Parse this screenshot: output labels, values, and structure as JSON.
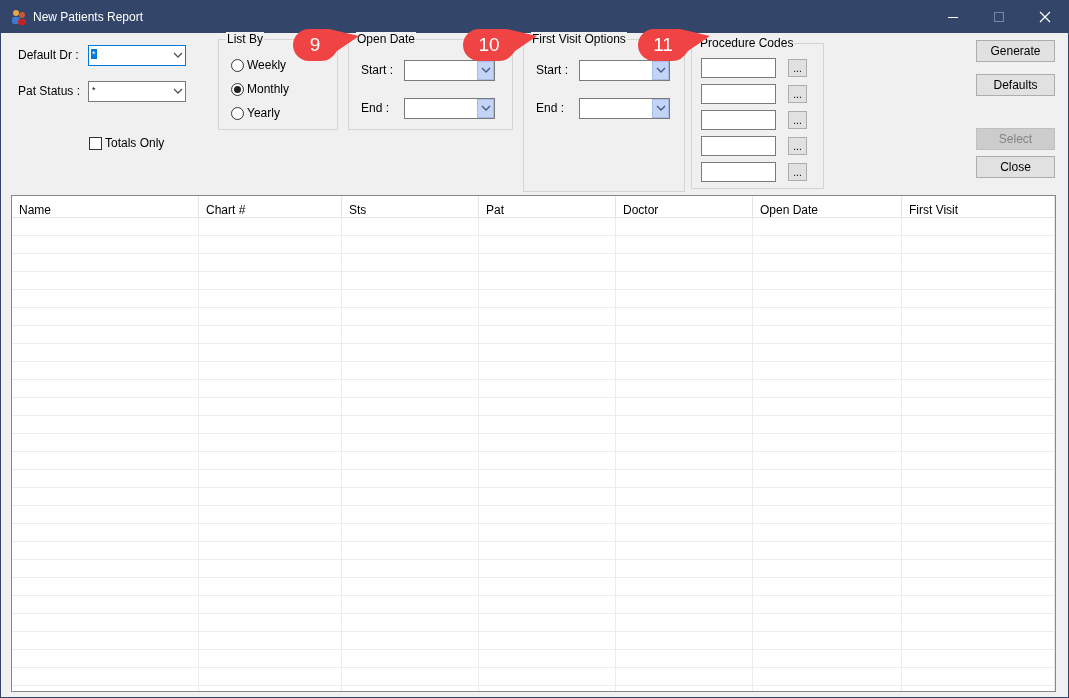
{
  "window": {
    "title": "New Patients Report"
  },
  "filters": [
    {
      "label": "Default Dr :",
      "value": "*",
      "focused": true
    },
    {
      "label": "Pat Status :",
      "value": "*",
      "focused": false
    }
  ],
  "totals_only": {
    "label": "Totals Only",
    "checked": false
  },
  "list_by": {
    "title": "List By",
    "options": [
      {
        "label": "Weekly",
        "selected": false
      },
      {
        "label": "Monthly",
        "selected": true
      },
      {
        "label": "Yearly",
        "selected": false
      }
    ]
  },
  "date_groups": [
    {
      "title": "Open Date",
      "fields": [
        {
          "label": "Start :"
        },
        {
          "label": "End :"
        }
      ]
    },
    {
      "title": "First Visit Options",
      "fields": [
        {
          "label": "Start :"
        },
        {
          "label": "End :"
        }
      ]
    }
  ],
  "procedure_codes": {
    "title": "Procedure Codes",
    "rows": [
      {
        "button": "..."
      },
      {
        "button": "..."
      },
      {
        "button": "..."
      },
      {
        "button": "..."
      },
      {
        "button": "..."
      }
    ]
  },
  "buttons": [
    {
      "label": "Generate",
      "disabled": false
    },
    {
      "label": "Defaults",
      "disabled": false
    },
    {
      "label": "Select",
      "disabled": true
    },
    {
      "label": "Close",
      "disabled": false
    }
  ],
  "table": {
    "columns": [
      "Name",
      "Chart #",
      "Sts",
      "Pat",
      "Doctor",
      "Open Date",
      "First Visit"
    ]
  },
  "callouts": [
    {
      "label": "9"
    },
    {
      "label": "10"
    },
    {
      "label": "11"
    }
  ]
}
